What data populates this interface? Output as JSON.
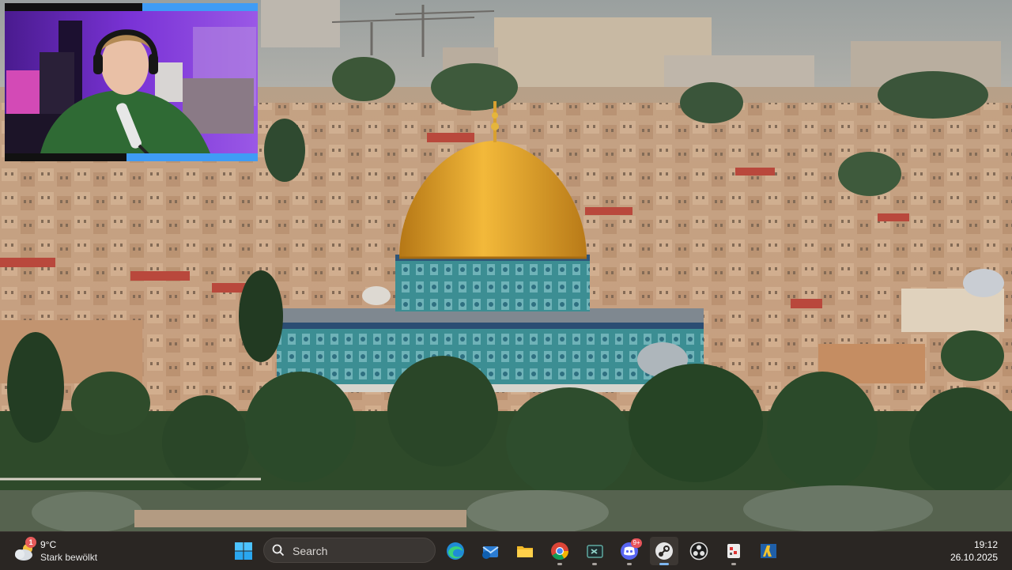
{
  "weather": {
    "badge": "1",
    "temperature": "9°C",
    "condition": "Stark bewölkt",
    "icon": "cloud-sun-icon"
  },
  "search": {
    "placeholder": "Search"
  },
  "taskbar_apps": [
    {
      "name": "start",
      "icon": "windows-logo-icon"
    },
    {
      "name": "edge",
      "icon": "edge-icon"
    },
    {
      "name": "outlook",
      "icon": "mail-icon"
    },
    {
      "name": "file-explorer",
      "icon": "folder-icon"
    },
    {
      "name": "chrome",
      "icon": "chrome-icon"
    },
    {
      "name": "terminal",
      "icon": "terminal-icon"
    },
    {
      "name": "discord",
      "icon": "discord-icon",
      "badge": "9+"
    },
    {
      "name": "steam",
      "icon": "steam-icon"
    },
    {
      "name": "obs",
      "icon": "obs-icon"
    },
    {
      "name": "app-red",
      "icon": "app-icon"
    },
    {
      "name": "game",
      "icon": "game-icon"
    }
  ],
  "clock": {
    "time": "19:12",
    "date": "26.10.2025"
  },
  "colors": {
    "taskbar": "#2a2623",
    "accent": "#3f9cf5",
    "dome_gold": "#e8a628"
  }
}
